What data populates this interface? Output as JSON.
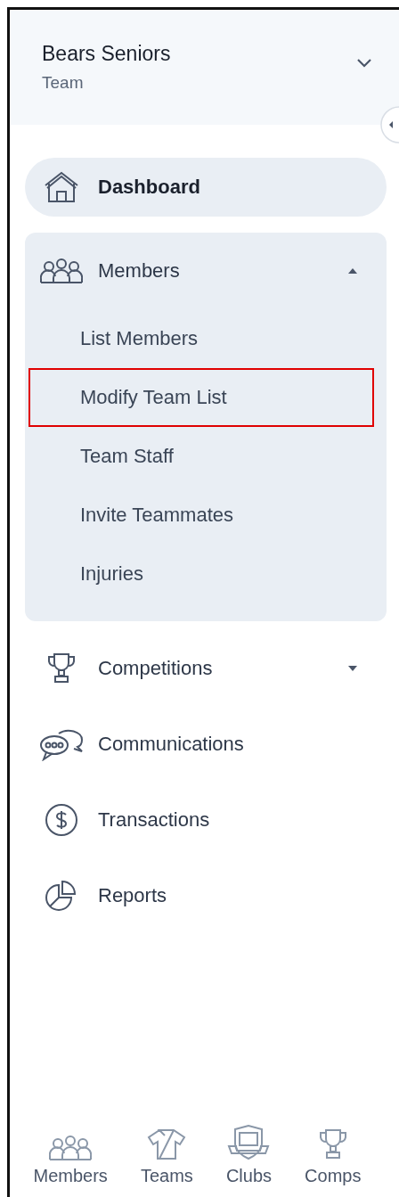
{
  "header": {
    "title": "Bears Seniors",
    "subtitle": "Team"
  },
  "nav": [
    {
      "label": "Dashboard",
      "selected": true
    },
    {
      "label": "Members",
      "selected": false,
      "expanded": true,
      "children": [
        {
          "label": "List Members",
          "highlighted": false
        },
        {
          "label": "Modify Team List",
          "highlighted": true
        },
        {
          "label": "Team Staff",
          "highlighted": false
        },
        {
          "label": "Invite Teammates",
          "highlighted": false
        },
        {
          "label": "Injuries",
          "highlighted": false
        }
      ]
    },
    {
      "label": "Competitions",
      "selected": false,
      "expanded": false
    },
    {
      "label": "Communications",
      "selected": false
    },
    {
      "label": "Transactions",
      "selected": false
    },
    {
      "label": "Reports",
      "selected": false
    }
  ],
  "bottom_nav": [
    {
      "label": "Members"
    },
    {
      "label": "Teams"
    },
    {
      "label": "Clubs"
    },
    {
      "label": "Comps"
    }
  ]
}
